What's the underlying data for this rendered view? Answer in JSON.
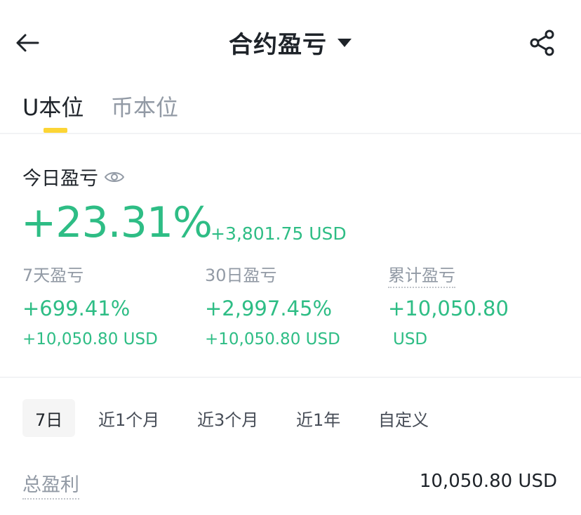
{
  "header": {
    "title": "合约盈亏",
    "icons": {
      "back": "arrow-left-icon",
      "dropdown": "caret-down-icon",
      "share": "share-icon"
    }
  },
  "tabs": [
    {
      "label": "U本位",
      "active": true
    },
    {
      "label": "币本位",
      "active": false
    }
  ],
  "today": {
    "label": "今日盈亏",
    "percent": "+23.31%",
    "amount": "+3,801.75 USD"
  },
  "stats": [
    {
      "label": "7天盈亏",
      "percent": "+699.41%",
      "amount": "+10,050.80 USD"
    },
    {
      "label": "30日盈亏",
      "percent": "+2,997.45%",
      "amount": "+10,050.80 USD"
    },
    {
      "label": "累计盈亏",
      "percent": "+10,050.80",
      "amount": "USD"
    }
  ],
  "ranges": [
    {
      "label": "7日",
      "active": true
    },
    {
      "label": "近1个月",
      "active": false
    },
    {
      "label": "近3个月",
      "active": false
    },
    {
      "label": "近1年",
      "active": false
    },
    {
      "label": "自定义",
      "active": false
    }
  ],
  "total": {
    "label": "总盈利",
    "value": "10,050.80 USD"
  },
  "colors": {
    "accent_yellow": "#fcd535",
    "profit_green": "#2ebd85",
    "text_primary": "#1e2329",
    "text_secondary": "#929aa5"
  }
}
